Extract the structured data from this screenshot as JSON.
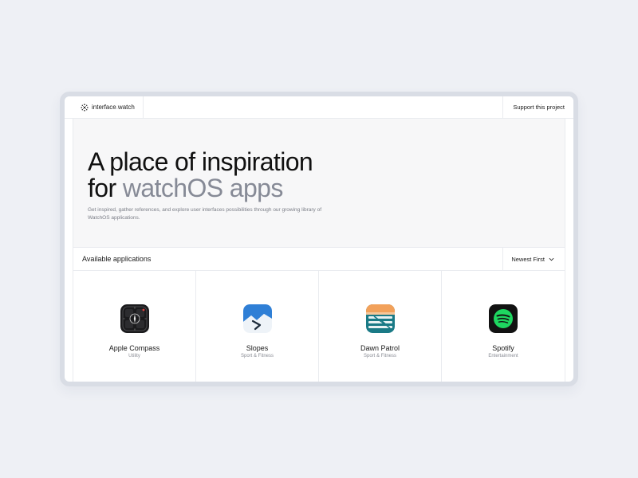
{
  "header": {
    "logo_name": "interface",
    "logo_dot": ".",
    "logo_suffix": "watch",
    "support_label": "Support this project"
  },
  "hero": {
    "title_line1": "A place of inspiration",
    "title_line2_prefix": "for ",
    "title_line2_highlight": "watchOS apps",
    "description": "Get inspired, gather references, and explore user interfaces possibilities through our growing library of WatchOS applications."
  },
  "list": {
    "title": "Available applications",
    "sort_label": "Newest First",
    "apps": [
      {
        "name": "Apple Compass",
        "category": "Utility",
        "icon": "compass-icon"
      },
      {
        "name": "Slopes",
        "category": "Sport & Fitness",
        "icon": "slopes-icon"
      },
      {
        "name": "Dawn Patrol",
        "category": "Sport & Fitness",
        "icon": "dawn-patrol-icon"
      },
      {
        "name": "Spotify",
        "category": "Entertainment",
        "icon": "spotify-icon"
      }
    ]
  },
  "colors": {
    "background": "#eef0f5",
    "hero_muted": "#868a96",
    "spotify_green": "#1ed760",
    "slopes_blue": "#2f7fd6",
    "dawn_orange": "#f2a15a",
    "dawn_teal": "#1a7a86"
  }
}
